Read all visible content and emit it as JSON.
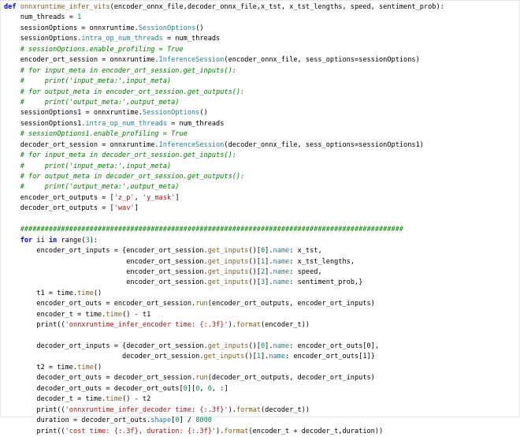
{
  "lines": [
    [
      [
        "kw",
        "def "
      ],
      [
        "fn",
        "onnxruntime_infer_vits"
      ],
      [
        "",
        "(encoder_onnx_file,decoder_onnx_file,x_tst, x_tst_lengths, speed, sentiment_prob):"
      ]
    ],
    [
      [
        "",
        "    num_threads = "
      ],
      [
        "nu",
        "1"
      ]
    ],
    [
      [
        "",
        "    sessionOptions = onnxruntime."
      ],
      [
        "at",
        "SessionOptions"
      ],
      [
        "",
        "()"
      ]
    ],
    [
      [
        "",
        "    sessionOptions."
      ],
      [
        "at",
        "intra_op_num_threads"
      ],
      [
        "",
        " = num_threads"
      ]
    ],
    [
      [
        "cm",
        "    # sessionOptions.enable_profiling = True"
      ]
    ],
    [
      [
        "",
        "    encoder_ort_session = onnxruntime."
      ],
      [
        "at",
        "InferenceSession"
      ],
      [
        "",
        "(encoder_onnx_file, sess_options=sessionOptions)"
      ]
    ],
    [
      [
        "cm",
        "    # for input_meta in encoder_ort_session.get_inputs():"
      ]
    ],
    [
      [
        "cm",
        "    #     print('input_meta:',input_meta)"
      ]
    ],
    [
      [
        "cm",
        "    # for output_meta in encoder_ort_session.get_outputs():"
      ]
    ],
    [
      [
        "cm",
        "    #     print('output_meta:',output_meta)"
      ]
    ],
    [
      [
        "",
        "    sessionOptions1 = onnxruntime."
      ],
      [
        "at",
        "SessionOptions"
      ],
      [
        "",
        "()"
      ]
    ],
    [
      [
        "",
        "    sessionOptions1."
      ],
      [
        "at",
        "intra_op_num_threads"
      ],
      [
        "",
        " = num_threads"
      ]
    ],
    [
      [
        "cm",
        "    # sessionOptions1.enable_profiling = True"
      ]
    ],
    [
      [
        "",
        "    decoder_ort_session = onnxruntime."
      ],
      [
        "at",
        "InferenceSession"
      ],
      [
        "",
        "(decoder_onnx_file, sess_options=sessionOptions1)"
      ]
    ],
    [
      [
        "cm",
        "    # for input_meta in decoder_ort_session.get_inputs():"
      ]
    ],
    [
      [
        "cm",
        "    #     print('input_meta:',input_meta)"
      ]
    ],
    [
      [
        "cm",
        "    # for output_meta in decoder_ort_session.get_outputs():"
      ]
    ],
    [
      [
        "cm",
        "    #     print('output_meta:',output_meta)"
      ]
    ],
    [
      [
        "",
        "    encoder_ort_outputs = ["
      ],
      [
        "st",
        "'z_p'"
      ],
      [
        "",
        ", "
      ],
      [
        "st",
        "'y_mask'"
      ],
      [
        "",
        "]"
      ]
    ],
    [
      [
        "",
        "    decoder_ort_outputs = ["
      ],
      [
        "st",
        "'wav'"
      ],
      [
        "",
        "]"
      ]
    ],
    [
      [
        "",
        ""
      ]
    ],
    [
      [
        "cm",
        "    ##############################################################################################"
      ]
    ],
    [
      [
        "",
        "    "
      ],
      [
        "kw",
        "for"
      ],
      [
        "",
        " ii "
      ],
      [
        "kw",
        "in"
      ],
      [
        "",
        " range("
      ],
      [
        "nu",
        "3"
      ],
      [
        "",
        "):"
      ]
    ],
    [
      [
        "",
        "        encoder_ort_inputs = {encoder_ort_session."
      ],
      [
        "fn",
        "get_inputs"
      ],
      [
        "",
        "()["
      ],
      [
        "nu",
        "0"
      ],
      [
        "",
        "]."
      ],
      [
        "at",
        "name"
      ],
      [
        "",
        ": x_tst,"
      ]
    ],
    [
      [
        "",
        "                              encoder_ort_session."
      ],
      [
        "fn",
        "get_inputs"
      ],
      [
        "",
        "()["
      ],
      [
        "nu",
        "1"
      ],
      [
        "",
        "]."
      ],
      [
        "at",
        "name"
      ],
      [
        "",
        ": x_tst_lengths,"
      ]
    ],
    [
      [
        "",
        "                              encoder_ort_session."
      ],
      [
        "fn",
        "get_inputs"
      ],
      [
        "",
        "()["
      ],
      [
        "nu",
        "2"
      ],
      [
        "",
        "]."
      ],
      [
        "at",
        "name"
      ],
      [
        "",
        ": speed,"
      ]
    ],
    [
      [
        "",
        "                              encoder_ort_session."
      ],
      [
        "fn",
        "get_inputs"
      ],
      [
        "",
        "()["
      ],
      [
        "nu",
        "3"
      ],
      [
        "",
        "]."
      ],
      [
        "at",
        "name"
      ],
      [
        "",
        ": sentiment_prob,}"
      ]
    ],
    [
      [
        "",
        "        t1 = time."
      ],
      [
        "fn",
        "time"
      ],
      [
        "",
        "()"
      ]
    ],
    [
      [
        "",
        "        encoder_ort_outs = encoder_ort_session."
      ],
      [
        "fn",
        "run"
      ],
      [
        "",
        "(encoder_ort_outputs, encoder_ort_inputs)"
      ]
    ],
    [
      [
        "",
        "        encoder_t = time."
      ],
      [
        "fn",
        "time"
      ],
      [
        "",
        "() - t1"
      ]
    ],
    [
      [
        "",
        "        print(("
      ],
      [
        "st",
        "'onnxruntime_infer_encoder time: {:.3f}'"
      ],
      [
        "",
        ")."
      ],
      [
        "fn",
        "format"
      ],
      [
        "",
        "(encoder_t))"
      ]
    ],
    [
      [
        "",
        ""
      ]
    ],
    [
      [
        "",
        "        decoder_ort_inputs = {decoder_ort_session."
      ],
      [
        "fn",
        "get_inputs"
      ],
      [
        "",
        "()["
      ],
      [
        "nu",
        "0"
      ],
      [
        "",
        "]."
      ],
      [
        "at",
        "name"
      ],
      [
        "",
        ": encoder_ort_outs[0],"
      ]
    ],
    [
      [
        "",
        "                             decoder_ort_session."
      ],
      [
        "fn",
        "get_inputs"
      ],
      [
        "",
        "()["
      ],
      [
        "nu",
        "1"
      ],
      [
        "",
        "]."
      ],
      [
        "at",
        "name"
      ],
      [
        "",
        ": encoder_ort_outs[1]}"
      ]
    ],
    [
      [
        "",
        "        t2 = time."
      ],
      [
        "fn",
        "time"
      ],
      [
        "",
        "()"
      ]
    ],
    [
      [
        "",
        "        decoder_ort_outs = decoder_ort_session."
      ],
      [
        "fn",
        "run"
      ],
      [
        "",
        "(decoder_ort_outputs, decoder_ort_inputs)"
      ]
    ],
    [
      [
        "",
        "        decoder_ort_outs = decoder_ort_outs["
      ],
      [
        "nu",
        "0"
      ],
      [
        "",
        "]["
      ],
      [
        "nu",
        "0"
      ],
      [
        "",
        ", "
      ],
      [
        "nu",
        "0"
      ],
      [
        "",
        ", :]"
      ]
    ],
    [
      [
        "",
        "        decoder_t = time."
      ],
      [
        "fn",
        "time"
      ],
      [
        "",
        "() - t2"
      ]
    ],
    [
      [
        "",
        "        print(("
      ],
      [
        "st",
        "'onnxruntime_infer_decoder time: {:.3f}'"
      ],
      [
        "",
        ")."
      ],
      [
        "fn",
        "format"
      ],
      [
        "",
        "(decoder_t))"
      ]
    ],
    [
      [
        "",
        "        duration = decoder_ort_outs."
      ],
      [
        "at",
        "shape"
      ],
      [
        "",
        "["
      ],
      [
        "nu",
        "0"
      ],
      [
        "",
        "] / "
      ],
      [
        "nu",
        "8000"
      ]
    ],
    [
      [
        "",
        "        print(("
      ],
      [
        "st",
        "'cost time: {:.3f}, duration: {:.3f}'"
      ],
      [
        "",
        ")."
      ],
      [
        "fn",
        "format"
      ],
      [
        "",
        "(encoder_t + decoder_t,duration))"
      ]
    ]
  ]
}
